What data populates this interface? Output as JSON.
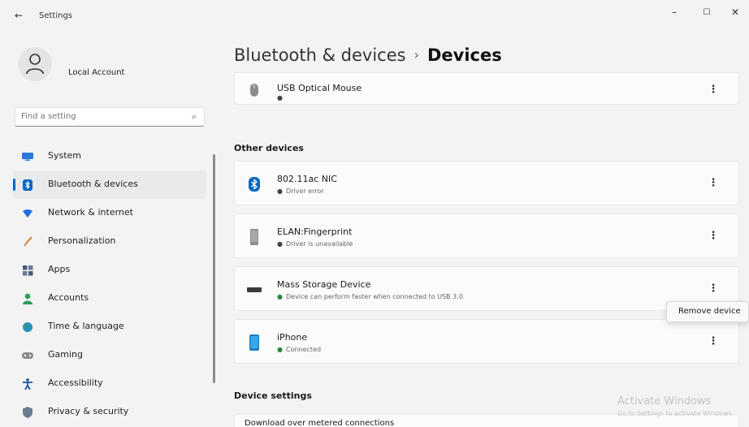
{
  "window": {
    "title": "Settings",
    "back": "←",
    "minimize": "–",
    "maximize": "☐",
    "close": "✕"
  },
  "account": {
    "name": "Local Account"
  },
  "search": {
    "placeholder": "Find a setting"
  },
  "nav": {
    "items": [
      {
        "label": "System",
        "icon": "system-icon",
        "color": "#2b79d6"
      },
      {
        "label": "Bluetooth & devices",
        "icon": "bluetooth-icon",
        "color": "#0067c0",
        "active": true
      },
      {
        "label": "Network & internet",
        "icon": "wifi-icon",
        "color": "#1d6fd8"
      },
      {
        "label": "Personalization",
        "icon": "brush-icon",
        "color": "#d97a2b"
      },
      {
        "label": "Apps",
        "icon": "apps-icon",
        "color": "#4a5a78"
      },
      {
        "label": "Accounts",
        "icon": "person-icon",
        "color": "#2e9d5c"
      },
      {
        "label": "Time & language",
        "icon": "globe-clock-icon",
        "color": "#2a8fc4"
      },
      {
        "label": "Gaming",
        "icon": "gamepad-icon",
        "color": "#8a8a8a"
      },
      {
        "label": "Accessibility",
        "icon": "accessibility-icon",
        "color": "#1b4f9c"
      },
      {
        "label": "Privacy & security",
        "icon": "shield-icon",
        "color": "#6b7b90"
      }
    ]
  },
  "breadcrumb": {
    "parent": "Bluetooth & devices",
    "separator": "›",
    "current": "Devices"
  },
  "devices_top": {
    "name": "USB Optical Mouse",
    "status": ""
  },
  "other_devices": {
    "heading": "Other devices",
    "items": [
      {
        "name": "802.11ac NIC",
        "status": "Driver error",
        "icon": "bluetooth-icon"
      },
      {
        "name": "ELAN:Fingerprint",
        "status": "Driver is unavailable",
        "icon": "device-icon"
      },
      {
        "name": "Mass Storage Device",
        "status": "Device can perform faster when connected to USB 3.0",
        "icon": "usb-drive-icon"
      },
      {
        "name": "iPhone",
        "status": "Connected",
        "icon": "phone-icon"
      }
    ]
  },
  "more_glyph": "⋮",
  "context_menu": {
    "item": "Remove device"
  },
  "device_settings": {
    "heading": "Device settings",
    "first_item": "Download over metered connections"
  },
  "watermark": {
    "title": "Activate Windows",
    "subtitle": "Go to Settings to activate Windows."
  }
}
